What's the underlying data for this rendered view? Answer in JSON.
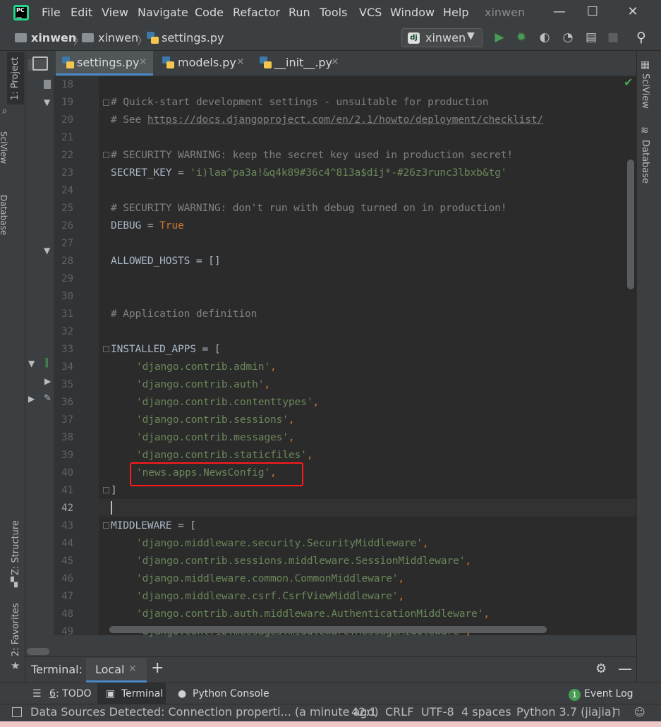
{
  "menubar": {
    "items": [
      "File",
      "Edit",
      "View",
      "Navigate",
      "Code",
      "Refactor",
      "Run",
      "Tools",
      "VCS",
      "Window",
      "Help"
    ],
    "window_title": "xinwen",
    "minimize": "—",
    "maximize": "☐",
    "close": "✕"
  },
  "navbar": {
    "crumb_root": "xinwen",
    "crumb_dir": "xinwen",
    "crumb_file": "settings.py",
    "run_config": "xinwen",
    "run_config_badge": "dj"
  },
  "tabs": [
    {
      "label": "settings.py",
      "close": "✕"
    },
    {
      "label": "models.py",
      "close": "✕"
    },
    {
      "label": "__init__.py",
      "close": "✕"
    }
  ],
  "left_strip": {
    "project_tab": "1: Project",
    "structure_tab": "Z: Structure",
    "favorites_tab": "2: Favorites",
    "sciview_partial": "SciView",
    "database_partial": "Database"
  },
  "right_strip": {
    "sciview": "SciView",
    "database": "Database"
  },
  "editor": {
    "line_numbers": [
      "18",
      "19",
      "20",
      "21",
      "22",
      "23",
      "24",
      "25",
      "26",
      "27",
      "28",
      "29",
      "30",
      "31",
      "32",
      "33",
      "34",
      "35",
      "36",
      "37",
      "38",
      "39",
      "40",
      "41",
      "42",
      "43",
      "44",
      "45",
      "46",
      "47",
      "48",
      "49"
    ],
    "lines": {
      "l19": "# Quick-start development settings - unsuitable for production",
      "l20_prefix": "# See ",
      "l20_link": "https://docs.djangoproject.com/en/2.1/howto/deployment/checklist/",
      "l22": "# SECURITY WARNING: keep the secret key used in production secret!",
      "l23_name": "SECRET_KEY = ",
      "l23_value": "'i)laa^pa3a!&q4k89#36c4^813a$dij*-#26z3runc3lbxb&tg'",
      "l25": "# SECURITY WARNING: don't run with debug turned on in production!",
      "l26_name": "DEBUG = ",
      "l26_value": "True",
      "l28": "ALLOWED_HOSTS = []",
      "l31": "# Application definition",
      "l33": "INSTALLED_APPS = [",
      "l34": "'django.contrib.admin'",
      "l35": "'django.contrib.auth'",
      "l36": "'django.contrib.contenttypes'",
      "l37": "'django.contrib.sessions'",
      "l38": "'django.contrib.messages'",
      "l39": "'django.contrib.staticfiles'",
      "l40": "'news.apps.NewsConfig'",
      "l41": "]",
      "l43": "MIDDLEWARE = [",
      "l44": "'django.middleware.security.SecurityMiddleware'",
      "l45": "'django.contrib.sessions.middleware.SessionMiddleware'",
      "l46": "'django.middleware.common.CommonMiddleware'",
      "l47": "'django.middleware.csrf.CsrfViewMiddleware'",
      "l48": "'django.contrib.auth.middleware.AuthenticationMiddleware'",
      "l49": "'django.contrib.messages.middleware.MessageMiddleware'",
      "comma": ","
    }
  },
  "terminal": {
    "title": "Terminal:",
    "tab": "Local",
    "tab_close": "✕",
    "add": "+"
  },
  "tool_windows": {
    "todo_num": "6",
    "todo": ": TODO",
    "terminal": "Terminal",
    "python_console": "Python Console",
    "event_log_count": "1",
    "event_log": "Event Log"
  },
  "statusbar": {
    "message": "Data Sources Detected: Connection properti... (a minute ago)",
    "position": "42:1",
    "line_sep": "CRLF",
    "encoding": "UTF-8",
    "indent": "4 spaces",
    "interpreter": "Python 3.7 (jiajia)"
  },
  "colors": {
    "accent": "#4a88c7",
    "highlight_box": "#ff1a1a",
    "string": "#6a8759",
    "keyword": "#cc7832",
    "comment": "#808080"
  }
}
